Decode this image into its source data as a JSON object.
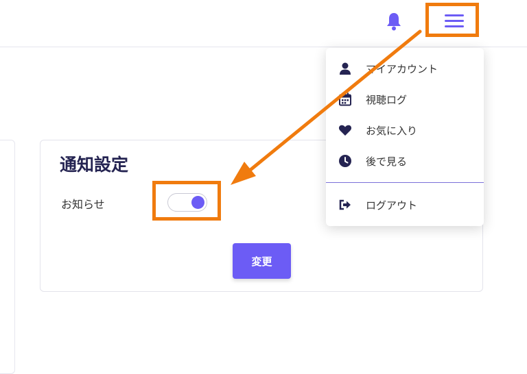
{
  "header": {
    "bell_icon": "bell-icon",
    "menu_icon": "hamburger-menu-icon",
    "accent_color": "#6c5cf5"
  },
  "card": {
    "title": "通知設定",
    "notification_label": "お知らせ",
    "notification_toggle_on": true,
    "change_button": "変更"
  },
  "dropdown": {
    "items": [
      {
        "label": "マイアカウント",
        "icon": "user-icon"
      },
      {
        "label": "視聴ログ",
        "icon": "calendar-icon"
      },
      {
        "label": "お気に入り",
        "icon": "heart-icon"
      },
      {
        "label": "後で見る",
        "icon": "clock-icon"
      }
    ],
    "logout": {
      "label": "ログアウト",
      "icon": "logout-icon"
    }
  },
  "annotation": {
    "highlight_color": "#f07b0e"
  }
}
